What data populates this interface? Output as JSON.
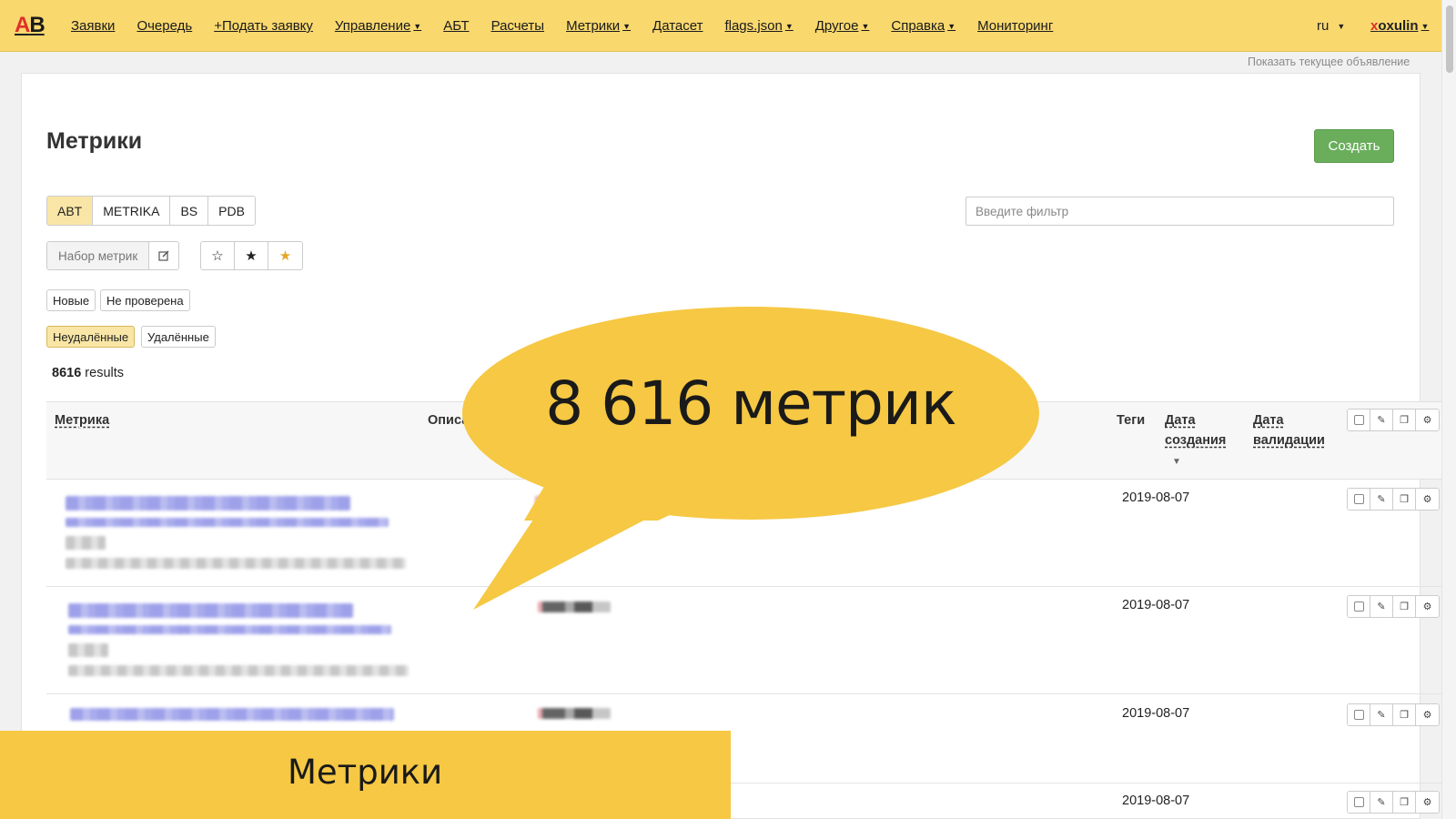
{
  "logo": {
    "first": "A",
    "second": "B"
  },
  "nav": [
    {
      "label": "Заявки",
      "dropdown": false
    },
    {
      "label": "Очередь",
      "dropdown": false
    },
    {
      "label": "+Подать заявку",
      "dropdown": false
    },
    {
      "label": "Управление",
      "dropdown": true
    },
    {
      "label": "АБТ",
      "dropdown": false
    },
    {
      "label": "Расчеты",
      "dropdown": false
    },
    {
      "label": "Метрики",
      "dropdown": true
    },
    {
      "label": "Датасет",
      "dropdown": false
    },
    {
      "label": "flags.json",
      "dropdown": true
    },
    {
      "label": "Другое",
      "dropdown": true
    },
    {
      "label": "Справка",
      "dropdown": true
    },
    {
      "label": "Мониторинг",
      "dropdown": false
    }
  ],
  "lang": "ru",
  "user": {
    "first_letter": "x",
    "rest": "oxulin"
  },
  "announcement_link": "Показать текущее объявление",
  "page": {
    "title": "Метрики",
    "create_label": "Создать",
    "sources": [
      {
        "label": "ABT",
        "active": true
      },
      {
        "label": "METRIKA",
        "active": false
      },
      {
        "label": "BS",
        "active": false
      },
      {
        "label": "PDB",
        "active": false
      }
    ],
    "filter_placeholder": "Введите фильтр",
    "metric_set_label": "Набор метрик",
    "star_icons": [
      "star-outline-icon",
      "star-filled-icon",
      "star-gold-icon"
    ],
    "status_filters": [
      {
        "label": "Новые",
        "active": false
      },
      {
        "label": "Не проверена",
        "active": false
      }
    ],
    "deleted_filters": [
      {
        "label": "Неудалённые",
        "active": true
      },
      {
        "label": "Удалённые",
        "active": false
      }
    ],
    "results": {
      "count": "8616",
      "label": "results"
    }
  },
  "table": {
    "headers": {
      "metric": "Метрика",
      "description": "Описание",
      "tags": "Теги",
      "created_1": "Дата",
      "created_2": "создания",
      "validated_1": "Дата",
      "validated_2": "валидации"
    },
    "sort_indicator": "▼",
    "rows": [
      {
        "created": "2019-08-07"
      },
      {
        "created": "2019-08-07"
      },
      {
        "created": "2019-08-07"
      },
      {
        "created": "2019-08-07"
      }
    ]
  },
  "overlay": {
    "bubble_text": "8 616 метрик",
    "banner_text": "Метрики",
    "colors": {
      "bubble": "#f6c843",
      "banner": "#f6c843"
    }
  },
  "colors": {
    "topbar": "#f9d86e",
    "create_button": "#6aae5c",
    "active_toggle": "#f9e6a6",
    "logo_red": "#e0302a"
  }
}
